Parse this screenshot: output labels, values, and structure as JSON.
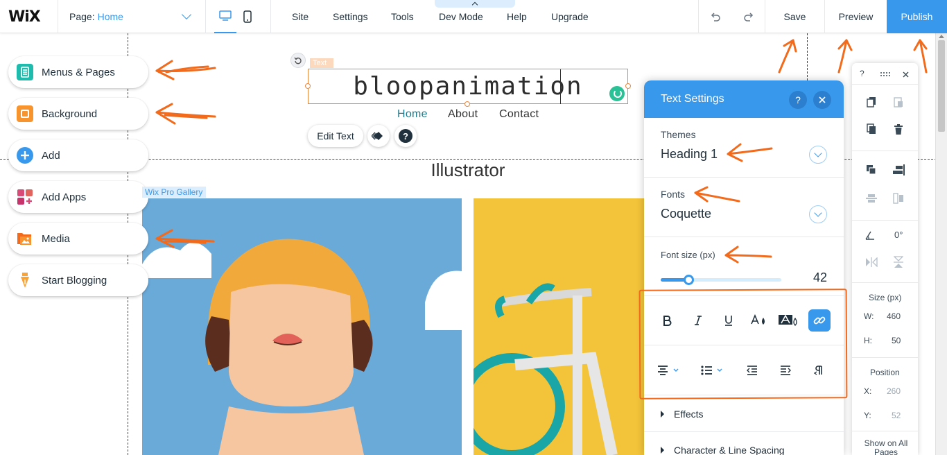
{
  "topbar": {
    "logo": "WiX",
    "page_label": "Page:",
    "page_value": "Home",
    "menu": [
      "Site",
      "Settings",
      "Tools",
      "Dev Mode",
      "Help",
      "Upgrade"
    ],
    "save": "Save",
    "preview": "Preview",
    "publish": "Publish"
  },
  "left_panel": {
    "items": [
      {
        "label": "Menus & Pages",
        "icon": "menus-pages-icon",
        "color": "#1fbcae"
      },
      {
        "label": "Background",
        "icon": "background-icon",
        "color": "#f7942e"
      },
      {
        "label": "Add",
        "icon": "add-icon",
        "color": "#3899ec"
      },
      {
        "label": "Add Apps",
        "icon": "add-apps-icon",
        "color": "#d94a79"
      },
      {
        "label": "Media",
        "icon": "media-icon",
        "color": "#f26a1b"
      },
      {
        "label": "Start Blogging",
        "icon": "blog-pen-icon",
        "color": "#f7a33a"
      }
    ]
  },
  "site": {
    "text_tag": "Text",
    "brand": "bloopanimation",
    "nav": [
      "Home",
      "About",
      "Contact"
    ],
    "edit_text": "Edit Text",
    "section_title": "Illustrator",
    "gallery_tag": "Wix Pro Gallery"
  },
  "text_settings": {
    "title": "Text Settings",
    "help": "?",
    "themes_label": "Themes",
    "themes_value": "Heading 1",
    "fonts_label": "Fonts",
    "fonts_value": "Coquette",
    "font_size_label": "Font size (px)",
    "font_size_value": "42",
    "font_size_fraction": 0.23,
    "effects": "Effects",
    "spacing": "Character & Line Spacing"
  },
  "right_toolbar": {
    "help": "?",
    "rotation": "0°",
    "size_label": "Size (px)",
    "w_label": "W:",
    "w_value": "460",
    "h_label": "H:",
    "h_value": "50",
    "position_label": "Position",
    "x_label": "X:",
    "x_value": "260",
    "y_label": "Y:",
    "y_value": "52",
    "show_all_pages": "Show on All Pages"
  },
  "colors": {
    "accent": "#3899ec",
    "annotation": "#f26a1b",
    "selection": "#e9883f"
  }
}
